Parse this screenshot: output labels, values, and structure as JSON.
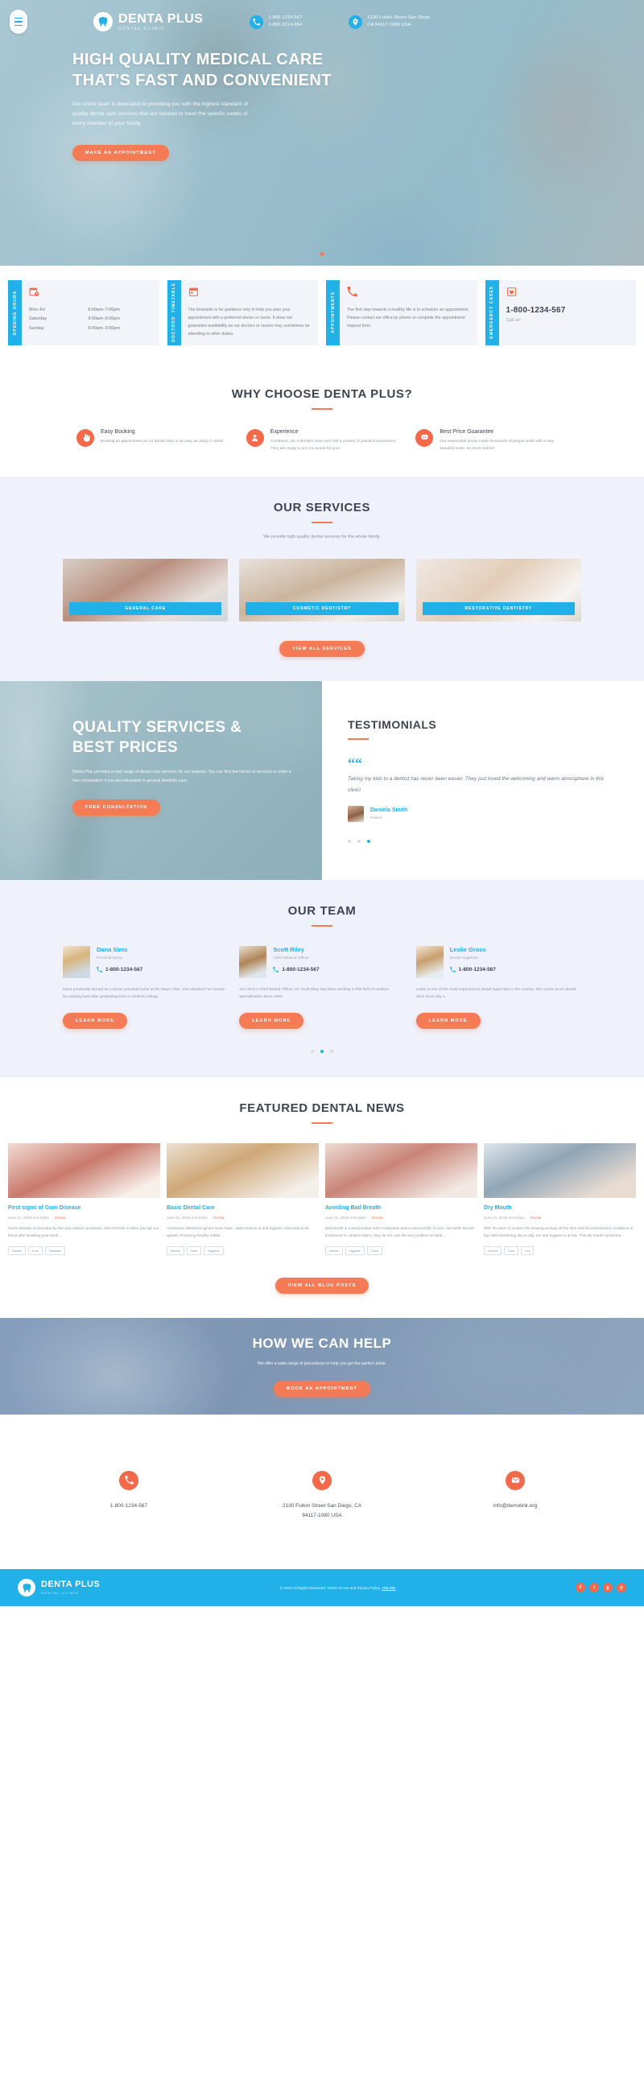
{
  "header": {
    "menu_icon": "hamburger-icon",
    "brand": {
      "name": "DENTA PLUS",
      "tagline": "DENTAL CLINIC",
      "logo_icon": "tooth-icon"
    },
    "phone": {
      "icon": "phone-icon",
      "line1": "1-800-1234-567",
      "line2": "1-800-3214-654"
    },
    "address": {
      "icon": "map-pin-icon",
      "line1": "2130 Fulton Street San Diego",
      "line2": "CA 94117-1080 USA"
    }
  },
  "hero": {
    "title_line1": "HIGH QUALITY MEDICAL CARE",
    "title_line2": "THAT'S FAST AND CONVENIENT",
    "paragraph": "Our entire team is dedicated to providing you with the highest standard of quality dental care services that are tailored to meet the specific needs of every member of your family.",
    "cta": "MAKE AN APPOINTMENT"
  },
  "info_cards": [
    {
      "tab": "OPENING HOURS",
      "icon": "calendar-clock-icon",
      "type": "hours",
      "hours": [
        {
          "day": "Mon–Fri",
          "time": "8:00am–7:00pm"
        },
        {
          "day": "Saturday",
          "time": "9:00am–5:00pm"
        },
        {
          "day": "Sunday",
          "time": "9:00am–3:00pm"
        }
      ]
    },
    {
      "tab": "DOCTORS' TIMETABLE",
      "icon": "calendar-icon",
      "type": "text",
      "text": "The timetable is for guidance only to help you plan your appointment with a preferred doctor or nurse. It does not guarantee availability as our doctors or nurses may sometimes be attending to other duties."
    },
    {
      "tab": "APPOINTMENTS",
      "icon": "phone-icon",
      "type": "text",
      "text": "The first step towards a healthy life is to schedule an appointment. Please contact our office by phone or complete the appointment request form."
    },
    {
      "tab": "EMERGENCY CASES",
      "icon": "heart-box-icon",
      "type": "phone",
      "phone": "1-800-1234-567",
      "sub": "Call us!"
    }
  ],
  "why": {
    "title": "WHY CHOOSE DENTA PLUS?",
    "features": [
      {
        "icon": "hand-click-icon",
        "title": "Easy Booking",
        "text": "Booking an appointment at our dental clinic is as easy as doing 2 clicks!"
      },
      {
        "icon": "user-badge-icon",
        "title": "Experience",
        "text": "Combined, our 5 dentists have over half a century of practical experience. They are ready to put it to action for you!"
      },
      {
        "icon": "tooth-care-icon",
        "title": "Best Price Guarantee",
        "text": "Our reasonable prices made thousands of people smile with a new, beautiful smile, as never before!"
      }
    ]
  },
  "services": {
    "title": "OUR SERVICES",
    "subtitle": "We provide high-quality dental services for the whole family.",
    "items": [
      {
        "label": "GENERAL CARE"
      },
      {
        "label": "COSMETIC DENTISTRY"
      },
      {
        "label": "RESTORATIVE DENTISTRY"
      }
    ],
    "cta": "VIEW ALL SERVICES"
  },
  "quality": {
    "title_line1": "QUALITY SERVICES &",
    "title_line2": "BEST PRICES",
    "paragraph": "Denta Plus provides a vast range of dental care services for our patients. You can find the full list of services or order a free consultation if you are interested in general dentistry care.",
    "cta": "FREE CONSULTATION"
  },
  "testimonials": {
    "title": "TESTIMONIALS",
    "quote_icon": "quote-icon",
    "quote": "Taking my kids to a dentist has never been easier. They just loved the welcoming and warm atmosphere in this clinic!",
    "author": "Daniela Smith",
    "role": "Patient",
    "dots": 3,
    "active_dot": 3
  },
  "team": {
    "title": "OUR TEAM",
    "members": [
      {
        "name": "Dana Sims",
        "role": "Practical Nurse",
        "phone": "1-800-1234-567",
        "bio": "Dana previously served as a senior practical nurse at the Mayo clinic. She obtained her license by working hard after graduating from a medical college.",
        "cta": "LEARN MORE"
      },
      {
        "name": "Scott Riley",
        "role": "Chief Medical Officer",
        "phone": "1-800-1234-567",
        "bio": "Our clinic's Chief Dental Officer, Dr. Scott Riley has been working in this field of medical specialization since 2002.",
        "cta": "LEARN MORE"
      },
      {
        "name": "Leslie Gross",
        "role": "Dental Hygienist",
        "phone": "1-800-1234-567",
        "bio": "Leslie is one of the most experienced dental hygienists in the country. She works at our dental clinic since day 1.",
        "cta": "LEARN MORE"
      }
    ],
    "dots": 3,
    "active_dot": 2
  },
  "news": {
    "title": "FEATURED DENTAL NEWS",
    "posts": [
      {
        "title": "First signs of Gum Disease",
        "date": "June 21, 2019 at 8:12pm",
        "category": "Dental",
        "excerpt": "Gums disease is preceded by few very distinct symptoms. One of these is when you spit out blood after brushing your teeth...",
        "tags": [
          "Dental",
          "Gum",
          "Disease"
        ]
      },
      {
        "title": "Basic Dental Care",
        "date": "June 21, 2019 at 8:12pm",
        "category": "Dental",
        "excerpt": "Americans oftentimes ignore some basic, daily routines of oral hygiene, that need to be upheld. Practicing healthy habits...",
        "tags": [
          "Dental",
          "Care",
          "Hygiene"
        ]
      },
      {
        "title": "Avoiding Bad Breath",
        "date": "June 21, 2019 at 8:12pm",
        "category": "Dental",
        "excerpt": "Bad breath is a deal breaker both in business and in personal life of ours. And while bruxist fresheners or candies hide it, they do not cure the very problem at hand...",
        "tags": [
          "Dental",
          "Hygiene",
          "Care"
        ]
      },
      {
        "title": "Dry Mouth",
        "date": "June 21, 2019 at 8:12pm",
        "category": "Dental",
        "excerpt": "With the pace of modern life keeping us busy all the time and the environment conditions in big cities worsening day to day, our oral hygiene is at risk. This dry mouth syndrome...",
        "tags": [
          "Dental",
          "Care",
          "Dry"
        ]
      }
    ],
    "cta": "VIEW ALL BLOG POSTS"
  },
  "help": {
    "title": "HOW WE CAN HELP",
    "subtitle": "We offer a wide range of procedures to help you get the perfect smile.",
    "cta": "BOOK AN APPOINTMENT"
  },
  "contacts": [
    {
      "icon": "phone-icon",
      "line1": "1-800-1234-567",
      "line2": ""
    },
    {
      "icon": "map-pin-icon",
      "line1": "2130 Fulton Street San Diego, CA",
      "line2": "94117-1080 USA"
    },
    {
      "icon": "mail-icon",
      "line1": "info@demolink.org",
      "line2": ""
    }
  ],
  "footer": {
    "brand_name": "DENTA PLUS",
    "brand_sub": "DENTAL CLINIC",
    "copyright": "© 2019 All Rights Reserved. Terms of Use and Privacy Policy. ",
    "copyright_link": "ONLINE",
    "social": [
      {
        "icon": "facebook-icon",
        "glyph": "f"
      },
      {
        "icon": "twitter-icon",
        "glyph": "t"
      },
      {
        "icon": "google-plus-icon",
        "glyph": "g"
      },
      {
        "icon": "pinterest-icon",
        "glyph": "p"
      }
    ]
  },
  "colors": {
    "accent_blue": "#22b0e8",
    "accent_orange": "#f47b56",
    "orange_solid": "#f4694a",
    "alt_bg": "#eff1fb"
  }
}
